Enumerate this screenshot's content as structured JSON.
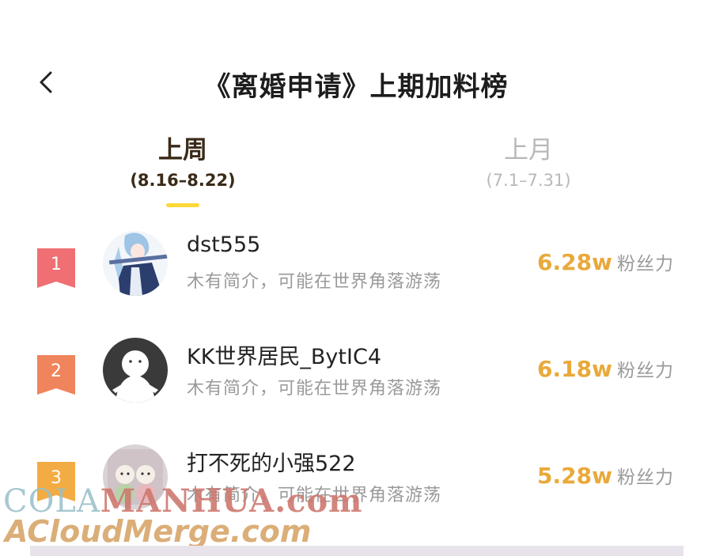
{
  "header": {
    "title": "《离婚申请》上期加料榜",
    "back_icon": "chevron-left-icon"
  },
  "tabs": [
    {
      "label": "上周",
      "range": "(8.16–8.22)",
      "active": true
    },
    {
      "label": "上月",
      "range": "(7.1–7.31)",
      "active": false
    }
  ],
  "ranking": [
    {
      "rank": "1",
      "rank_color": "#ef6f72",
      "name": "dst555",
      "bio": "木有简介，可能在世界角落游荡",
      "fans_value": "6.28w",
      "fans_label": "粉丝力"
    },
    {
      "rank": "2",
      "rank_color": "#f0845c",
      "name": "KK世界居民_BytIC4",
      "bio": "木有简介，可能在世界角落游荡",
      "fans_value": "6.18w",
      "fans_label": "粉丝力"
    },
    {
      "rank": "3",
      "rank_color": "#f3ac43",
      "name": "打不死的小强522",
      "bio": "木有简介，可能在世界角落游荡",
      "fans_value": "5.28w",
      "fans_label": "粉丝力"
    }
  ],
  "watermarks": {
    "line1_a": "COLA",
    "line1_b": "MANHUA.com",
    "line2": "ACloudMerge.com"
  },
  "colors": {
    "accent": "#e9a93a",
    "indicator": "#ffd83a"
  }
}
